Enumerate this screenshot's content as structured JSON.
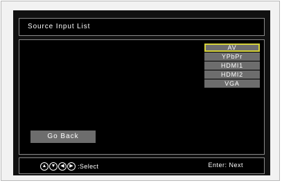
{
  "title": "Source Input List",
  "sources": [
    "AV",
    "YPbPr",
    "HDMI1",
    "HDMI2",
    "VGA"
  ],
  "selected_source": "AV",
  "go_back_label": "Go Back",
  "footer": {
    "nav_icons": [
      "up-arrow-icon",
      "down-arrow-icon",
      "left-arrow-icon",
      "right-arrow-icon"
    ],
    "select_label": ":Select",
    "enter_label": "Enter: Next"
  },
  "colors": {
    "selected_border": "#d6d33a",
    "item_background": "#6d6d6d",
    "panel_background": "#000000",
    "panel_border": "#8a8a8a"
  }
}
